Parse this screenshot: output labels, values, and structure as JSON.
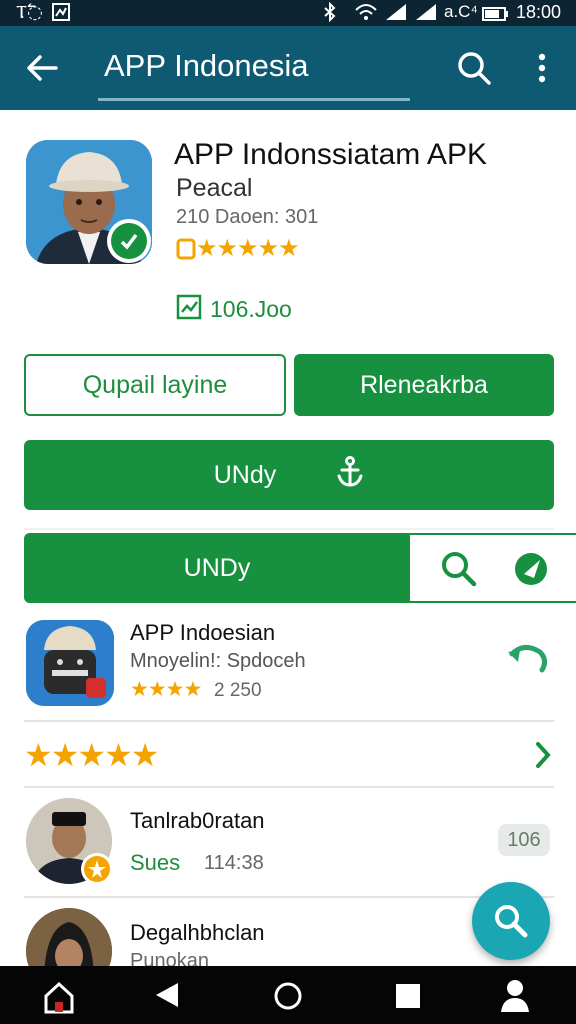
{
  "status_bar": {
    "left_icon": "Ⲧ߱",
    "time": "18:00",
    "battery_text": "a.C⁴"
  },
  "app_bar": {
    "title": "APP Indonesia"
  },
  "header": {
    "title": "APP Indonssiatam APK",
    "subtitle": "Peacal",
    "meta": "210 Daoen: 301",
    "stars": "★★★★★",
    "downloads": "106.Joo"
  },
  "buttons": {
    "outline_label": "Qupail layine",
    "filled_label": "Rleneakrba",
    "download_label": "UNdy",
    "segment_label": "UNDy"
  },
  "list": {
    "item1": {
      "title": "APP Indoesian",
      "subtitle": "Mnoyelin!: Spdoceh",
      "stars": "★★★★",
      "rating": "2 250"
    },
    "rating_row": {
      "stars": "★★★★★"
    },
    "item2": {
      "title": "Tanlrab0ratan",
      "tag": "Sues",
      "time": "114:38",
      "badge": "106"
    },
    "item3": {
      "title": "Degalhbhclan",
      "subtitle": "Punokan"
    }
  },
  "colors": {
    "primary": "#0f5a73",
    "accent": "#17913f",
    "fab": "#1aa6b2",
    "star": "#f4a400"
  }
}
